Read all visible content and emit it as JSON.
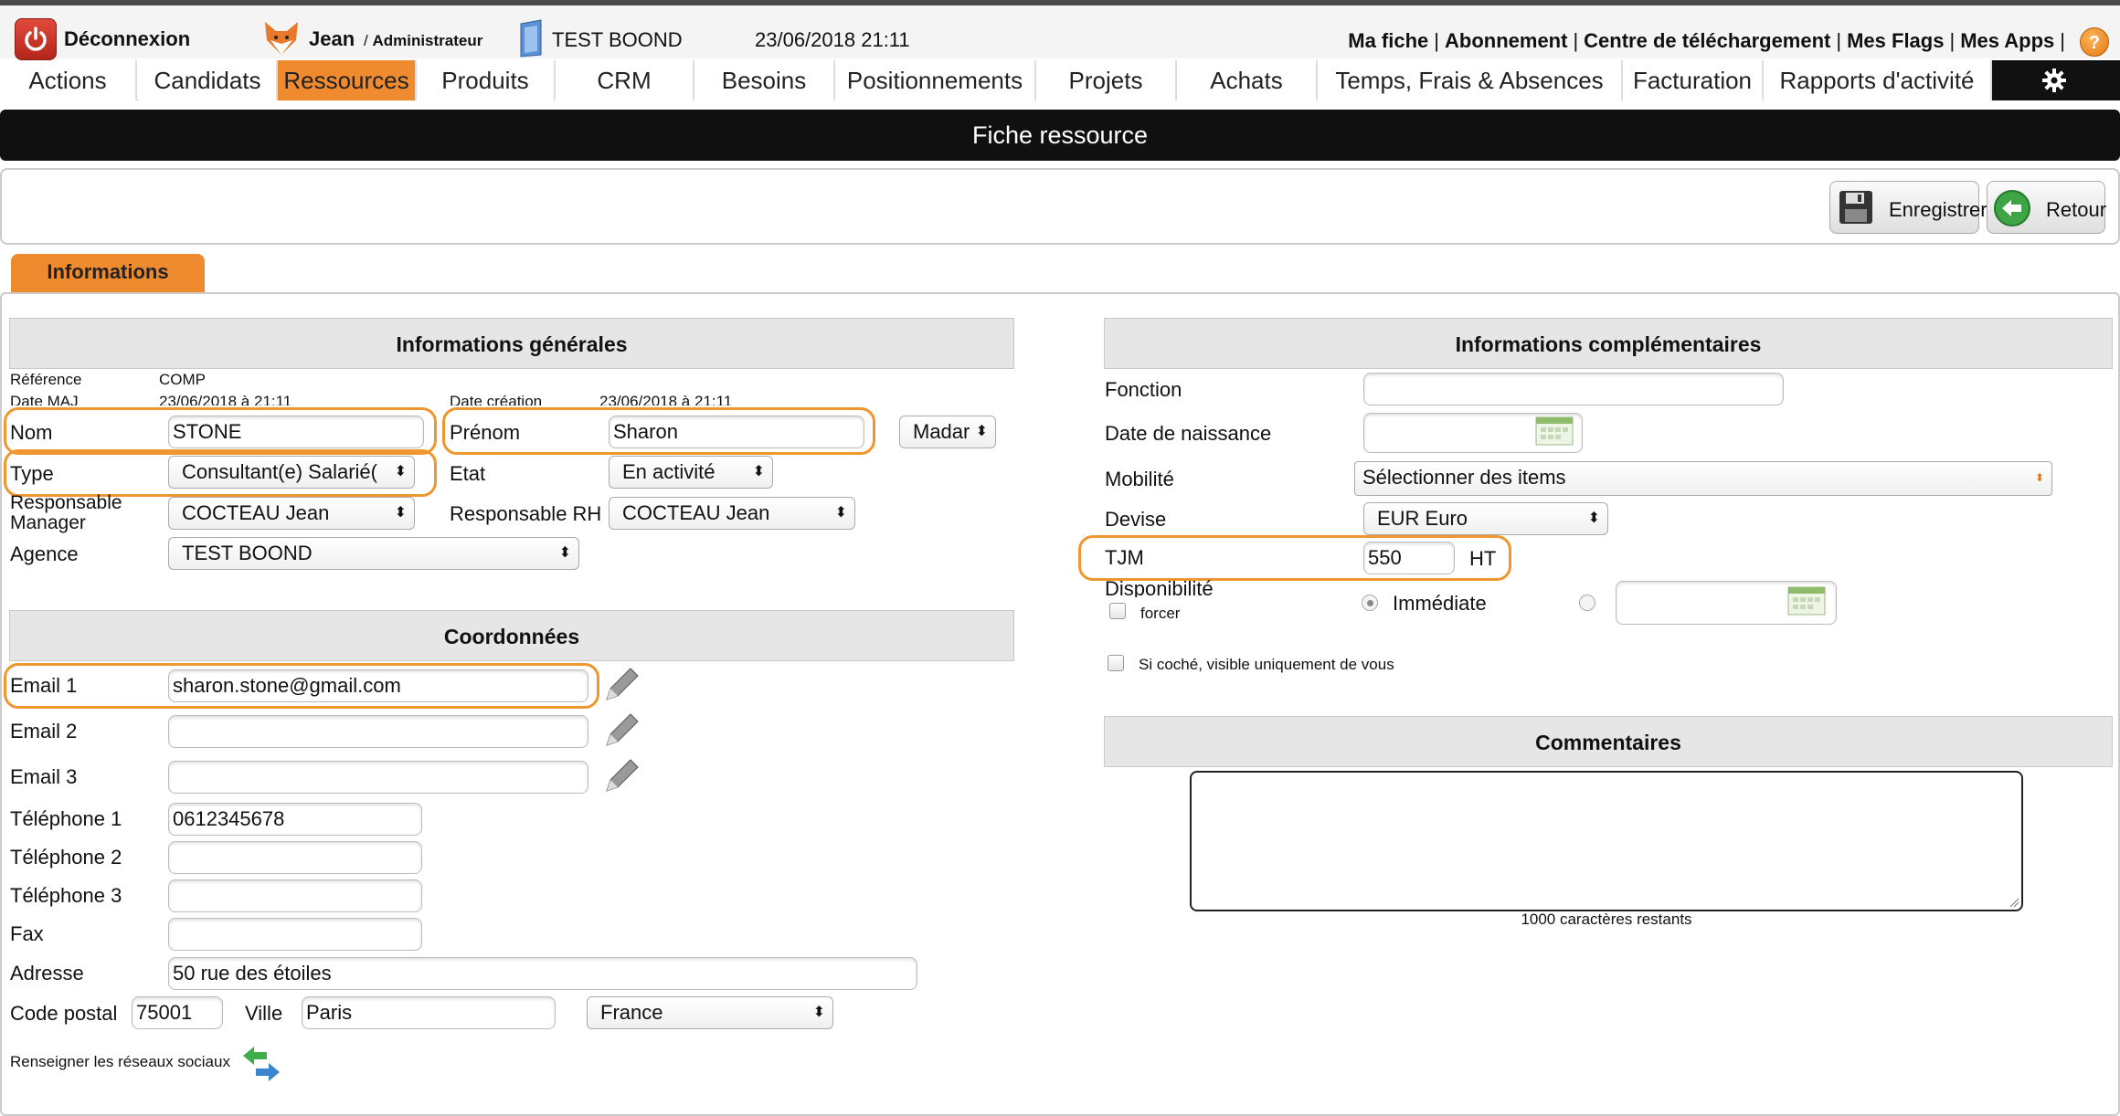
{
  "header": {
    "logout_label": "Déconnexion",
    "user_name": "Jean",
    "user_role": "Administrateur",
    "company": "TEST BOOND",
    "datetime": "23/06/2018 21:11",
    "links": [
      "Ma fiche",
      "Abonnement",
      "Centre de téléchargement",
      "Mes Flags",
      "Mes Apps"
    ],
    "help": "?"
  },
  "nav": {
    "items": [
      "Actions",
      "Candidats",
      "Ressources",
      "Produits",
      "CRM",
      "Besoins",
      "Positionnements",
      "Projets",
      "Achats",
      "Temps, Frais & Absences",
      "Facturation",
      "Rapports d'activité"
    ],
    "active": "Ressources"
  },
  "page_title": "Fiche ressource",
  "toolbar": {
    "save_label": "Enregistrer",
    "back_label": "Retour"
  },
  "tab": {
    "label": "Informations"
  },
  "general": {
    "title": "Informations générales",
    "reference_label": "Référence",
    "reference_value": "COMP",
    "date_maj_label": "Date MAJ",
    "date_maj_value": "23/06/2018 à 21:11",
    "date_creation_label": "Date création",
    "date_creation_value": "23/06/2018 à 21:11",
    "nom_label": "Nom",
    "nom_value": "STONE",
    "prenom_label": "Prénom",
    "prenom_value": "Sharon",
    "civilite_value": "Madar",
    "type_label": "Type",
    "type_value": "Consultant(e) Salarié(",
    "etat_label": "Etat",
    "etat_value": "En activité",
    "manager_label_1": "Responsable",
    "manager_label_2": "Manager",
    "manager_value": "COCTEAU Jean",
    "rh_label": "Responsable RH",
    "rh_value": "COCTEAU Jean",
    "agence_label": "Agence",
    "agence_value": "TEST BOOND"
  },
  "coordonnees": {
    "title": "Coordonnées",
    "email1_label": "Email 1",
    "email1_value": "sharon.stone@gmail.com",
    "email2_label": "Email 2",
    "email2_value": "",
    "email3_label": "Email 3",
    "email3_value": "",
    "tel1_label": "Téléphone 1",
    "tel1_value": "0612345678",
    "tel2_label": "Téléphone 2",
    "tel2_value": "",
    "tel3_label": "Téléphone 3",
    "tel3_value": "",
    "fax_label": "Fax",
    "fax_value": "",
    "adresse_label": "Adresse",
    "adresse_value": "50 rue des étoiles",
    "cp_label": "Code postal",
    "cp_value": "75001",
    "ville_label": "Ville",
    "ville_value": "Paris",
    "pays_value": "France",
    "social_label": "Renseigner les réseaux sociaux"
  },
  "complementaires": {
    "title": "Informations complémentaires",
    "fonction_label": "Fonction",
    "fonction_value": "",
    "naissance_label": "Date de naissance",
    "naissance_value": "",
    "mobilite_label": "Mobilité",
    "mobilite_value": "Sélectionner des items",
    "devise_label": "Devise",
    "devise_value": "EUR Euro",
    "tjm_label": "TJM",
    "tjm_value": "550",
    "tjm_unit": "HT",
    "dispo_label": "Disponibilité",
    "forcer_label": "forcer",
    "immediate_label": "Immédiate",
    "dispo_date_value": "",
    "visible_label": "Si coché, visible uniquement de vous"
  },
  "commentaires": {
    "title": "Commentaires",
    "value": "",
    "remaining": "1000 caractères restants"
  },
  "colors": {
    "accent": "#f08a2e",
    "highlight": "#f0962e",
    "titlebar": "#101010"
  }
}
